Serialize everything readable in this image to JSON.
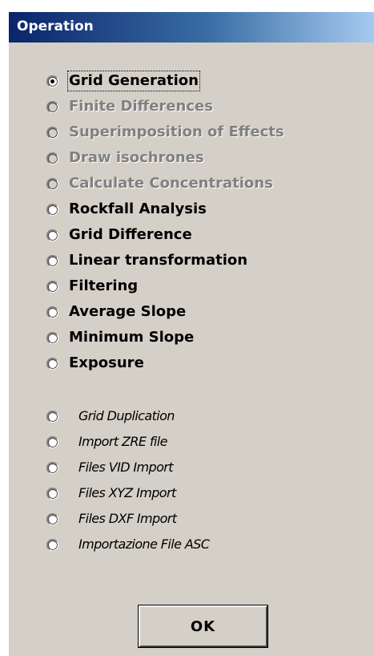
{
  "window": {
    "title": "Operation"
  },
  "options_main": [
    {
      "label": "Grid Generation",
      "checked": true,
      "disabled": false
    },
    {
      "label": "Finite Differences",
      "checked": false,
      "disabled": true
    },
    {
      "label": "Superimposition of Effects",
      "checked": false,
      "disabled": true
    },
    {
      "label": "Draw isochrones",
      "checked": false,
      "disabled": true
    },
    {
      "label": "Calculate Concentrations",
      "checked": false,
      "disabled": true
    },
    {
      "label": "Rockfall Analysis",
      "checked": false,
      "disabled": false
    },
    {
      "label": "Grid Difference",
      "checked": false,
      "disabled": false
    },
    {
      "label": "Linear transformation",
      "checked": false,
      "disabled": false
    },
    {
      "label": "Filtering",
      "checked": false,
      "disabled": false
    },
    {
      "label": "Average Slope",
      "checked": false,
      "disabled": false
    },
    {
      "label": "Minimum Slope",
      "checked": false,
      "disabled": false
    },
    {
      "label": "Exposure",
      "checked": false,
      "disabled": false
    }
  ],
  "options_import": [
    {
      "label": "Grid Duplication",
      "checked": false,
      "disabled": false
    },
    {
      "label": "Import ZRE file",
      "checked": false,
      "disabled": false
    },
    {
      "label": "Files VID Import",
      "checked": false,
      "disabled": false
    },
    {
      "label": "Files XYZ Import",
      "checked": false,
      "disabled": false
    },
    {
      "label": "Files DXF Import",
      "checked": false,
      "disabled": false
    },
    {
      "label": "Importazione File ASC",
      "checked": false,
      "disabled": false
    }
  ],
  "buttons": {
    "ok_label": "OK"
  }
}
